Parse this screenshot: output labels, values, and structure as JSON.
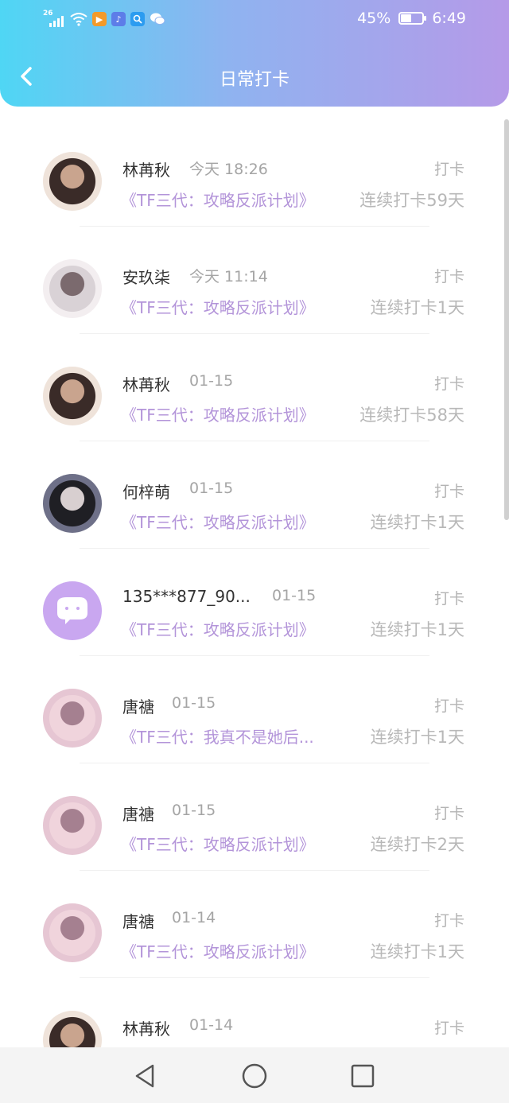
{
  "status": {
    "network": "26",
    "battery_text": "45%",
    "battery_level": 0.45,
    "time": "6:49"
  },
  "header": {
    "title": "日常打卡"
  },
  "colors": {
    "accent_start": "#4fd6f4",
    "accent_end": "#b59ae8",
    "book_title": "#b394d9"
  },
  "items": [
    {
      "name": "林苒秋",
      "time": "今天 18:26",
      "tag": "打卡",
      "book": "《TF三代：攻略反派计划》",
      "streak": "连续打卡59天",
      "avatar": "photo"
    },
    {
      "name": "安玖柒",
      "time": "今天 11:14",
      "tag": "打卡",
      "book": "《TF三代：攻略反派计划》",
      "streak": "连续打卡1天",
      "avatar": "photo"
    },
    {
      "name": "林苒秋",
      "time": "01-15",
      "tag": "打卡",
      "book": "《TF三代：攻略反派计划》",
      "streak": "连续打卡58天",
      "avatar": "photo"
    },
    {
      "name": "何梓萌",
      "time": "01-15",
      "tag": "打卡",
      "book": "《TF三代：攻略反派计划》",
      "streak": "连续打卡1天",
      "avatar": "photo"
    },
    {
      "name": "135***877_90...",
      "time": "01-15",
      "tag": "打卡",
      "book": "《TF三代：攻略反派计划》",
      "streak": "连续打卡1天",
      "avatar": "default-chat-avatar"
    },
    {
      "name": "唐禟",
      "time": "01-15",
      "tag": "打卡",
      "book": "《TF三代：我真不是她后...",
      "streak": "连续打卡1天",
      "avatar": "photo"
    },
    {
      "name": "唐禟",
      "time": "01-15",
      "tag": "打卡",
      "book": "《TF三代：攻略反派计划》",
      "streak": "连续打卡2天",
      "avatar": "photo"
    },
    {
      "name": "唐禟",
      "time": "01-14",
      "tag": "打卡",
      "book": "《TF三代：攻略反派计划》",
      "streak": "连续打卡1天",
      "avatar": "photo"
    },
    {
      "name": "林苒秋",
      "time": "01-14",
      "tag": "打卡",
      "book": "",
      "streak": "",
      "avatar": "photo"
    }
  ],
  "navbar": {
    "icons": [
      "back-triangle-icon",
      "home-circle-icon",
      "recents-square-icon"
    ]
  }
}
